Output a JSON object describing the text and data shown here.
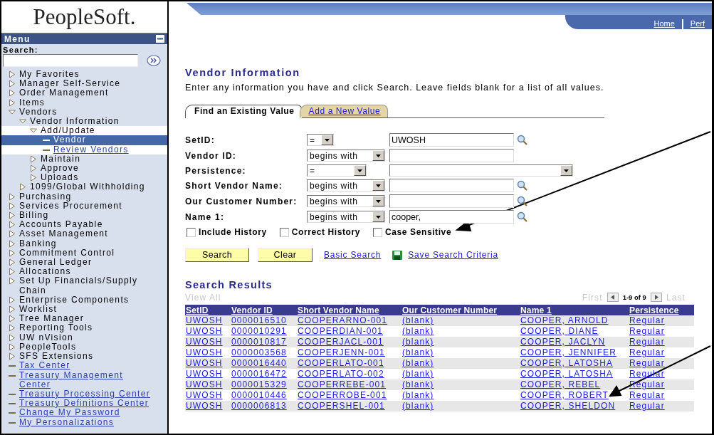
{
  "logo": "PeopleSoft.",
  "menu": {
    "title": "Menu",
    "search_label": "Search:",
    "items": [
      {
        "label": "My Favorites",
        "kind": "folder",
        "expanded": false
      },
      {
        "label": "Manager Self-Service",
        "kind": "folder",
        "expanded": false
      },
      {
        "label": "Order Management",
        "kind": "folder",
        "expanded": false
      },
      {
        "label": "Items",
        "kind": "folder",
        "expanded": false
      },
      {
        "label": "Vendors",
        "kind": "folder",
        "expanded": true,
        "children": [
          {
            "label": "Vendor Information",
            "kind": "folder",
            "expanded": true,
            "children": [
              {
                "label": "Add/Update",
                "kind": "folder",
                "expanded": true,
                "current": true,
                "children": [
                  {
                    "label": "Vendor",
                    "kind": "link",
                    "selected": true
                  },
                  {
                    "label": "Review Vendors",
                    "kind": "link",
                    "selected": false
                  }
                ]
              },
              {
                "label": "Maintain",
                "kind": "folder",
                "expanded": false
              },
              {
                "label": "Approve",
                "kind": "folder",
                "expanded": false
              },
              {
                "label": "Uploads",
                "kind": "folder",
                "expanded": false
              }
            ]
          },
          {
            "label": "1099/Global Withholding",
            "kind": "folder",
            "expanded": false
          }
        ]
      },
      {
        "label": "Purchasing",
        "kind": "folder",
        "expanded": false
      },
      {
        "label": "Services Procurement",
        "kind": "folder",
        "expanded": false
      },
      {
        "label": "Billing",
        "kind": "folder",
        "expanded": false
      },
      {
        "label": "Accounts Payable",
        "kind": "folder",
        "expanded": false
      },
      {
        "label": "Asset Management",
        "kind": "folder",
        "expanded": false
      },
      {
        "label": "Banking",
        "kind": "folder",
        "expanded": false
      },
      {
        "label": "Commitment Control",
        "kind": "folder",
        "expanded": false
      },
      {
        "label": "General Ledger",
        "kind": "folder",
        "expanded": false
      },
      {
        "label": "Allocations",
        "kind": "folder",
        "expanded": false
      },
      {
        "label": "Set Up Financials/Supply Chain",
        "kind": "folder",
        "expanded": false
      },
      {
        "label": "Enterprise Components",
        "kind": "folder",
        "expanded": false
      },
      {
        "label": "Worklist",
        "kind": "folder",
        "expanded": false
      },
      {
        "label": "Tree Manager",
        "kind": "folder",
        "expanded": false
      },
      {
        "label": "Reporting Tools",
        "kind": "folder",
        "expanded": false
      },
      {
        "label": "UW nVision",
        "kind": "folder",
        "expanded": false
      },
      {
        "label": "PeopleTools",
        "kind": "folder",
        "expanded": false
      },
      {
        "label": "SFS Extensions",
        "kind": "folder",
        "expanded": false
      },
      {
        "label": "Tax Center",
        "kind": "link",
        "selected": false
      },
      {
        "label": "Treasury Management Center",
        "kind": "link",
        "selected": false
      },
      {
        "label": "Treasury Processing Center",
        "kind": "link",
        "selected": false
      },
      {
        "label": "Treasury Definitions Center",
        "kind": "link",
        "selected": false
      },
      {
        "label": "Change My Password",
        "kind": "link",
        "selected": false
      },
      {
        "label": "My Personalizations",
        "kind": "link",
        "selected": false
      }
    ]
  },
  "header_links": [
    "Home",
    "Perf"
  ],
  "page": {
    "title": "Vendor Information",
    "instructions": "Enter any information you have and click Search. Leave fields blank for a list of all values.",
    "tabs": [
      {
        "label": "Find an Existing Value",
        "selected": true
      },
      {
        "label": "Add a New Value",
        "selected": false
      }
    ],
    "fields": [
      {
        "label": "SetID:",
        "operator": "=",
        "kind": "lookup",
        "value": "UWOSH"
      },
      {
        "label": "Vendor ID:",
        "operator": "begins with",
        "kind": "text"
      },
      {
        "label": "Persistence:",
        "operator": "=",
        "kind": "select"
      },
      {
        "label": "Short Vendor Name:",
        "operator": "begins with",
        "kind": "lookup"
      },
      {
        "label": "Our Customer Number:",
        "operator": "begins with",
        "kind": "lookup"
      },
      {
        "label": "Name 1:",
        "operator": "begins with",
        "kind": "lookup",
        "value": "cooper,"
      }
    ],
    "checkboxes": [
      {
        "label": "Include History",
        "checked": false
      },
      {
        "label": "Correct History",
        "checked": false
      },
      {
        "label": "Case Sensitive",
        "checked": false
      }
    ],
    "buttons": [
      "Search",
      "Clear"
    ],
    "links": [
      {
        "label": "Basic Search",
        "kind": "plain"
      },
      {
        "label": "Save Search Criteria",
        "kind": "save"
      }
    ]
  },
  "results": {
    "title": "Search Results",
    "view_all": {
      "label": "View All",
      "disabled": true
    },
    "pager": {
      "first": "First",
      "range": "1-9 of 9",
      "last": "Last"
    },
    "columns": [
      "SetID",
      "Vendor ID",
      "Short Vendor Name",
      "Our Customer Number",
      "Name 1",
      "Persistence"
    ],
    "rows": [
      [
        "UWOSH",
        "0000016510",
        "COOPERARNO-001",
        "(blank)",
        "COOPER, ARNOLD",
        "Regular"
      ],
      [
        "UWOSH",
        "0000010291",
        "COOPERDIAN-001",
        "(blank)",
        "COOPER, DIANE",
        "Regular"
      ],
      [
        "UWOSH",
        "0000010817",
        "COOPERJACL-001",
        "(blank)",
        "COOPER, JACLYN",
        "Regular"
      ],
      [
        "UWOSH",
        "0000003568",
        "COOPERJENN-001",
        "(blank)",
        "COOPER, JENNIFER",
        "Regular"
      ],
      [
        "UWOSH",
        "0000016440",
        "COOPERLATO-001",
        "(blank)",
        "COOPER, LATOSHA",
        "Regular"
      ],
      [
        "UWOSH",
        "0000016472",
        "COOPERLATO-002",
        "(blank)",
        "COOPER, LATOSHA",
        "Regular"
      ],
      [
        "UWOSH",
        "0000015329",
        "COOPERREBE-001",
        "(blank)",
        "COOPER, REBEL",
        "Regular"
      ],
      [
        "UWOSH",
        "0000010446",
        "COOPERROBE-001",
        "(blank)",
        "COOPER, ROBERT",
        "Regular"
      ],
      [
        "UWOSH",
        "0000006813",
        "COOPERSHEL-001",
        "(blank)",
        "COOPER, SHELDON",
        "Regular"
      ]
    ]
  }
}
